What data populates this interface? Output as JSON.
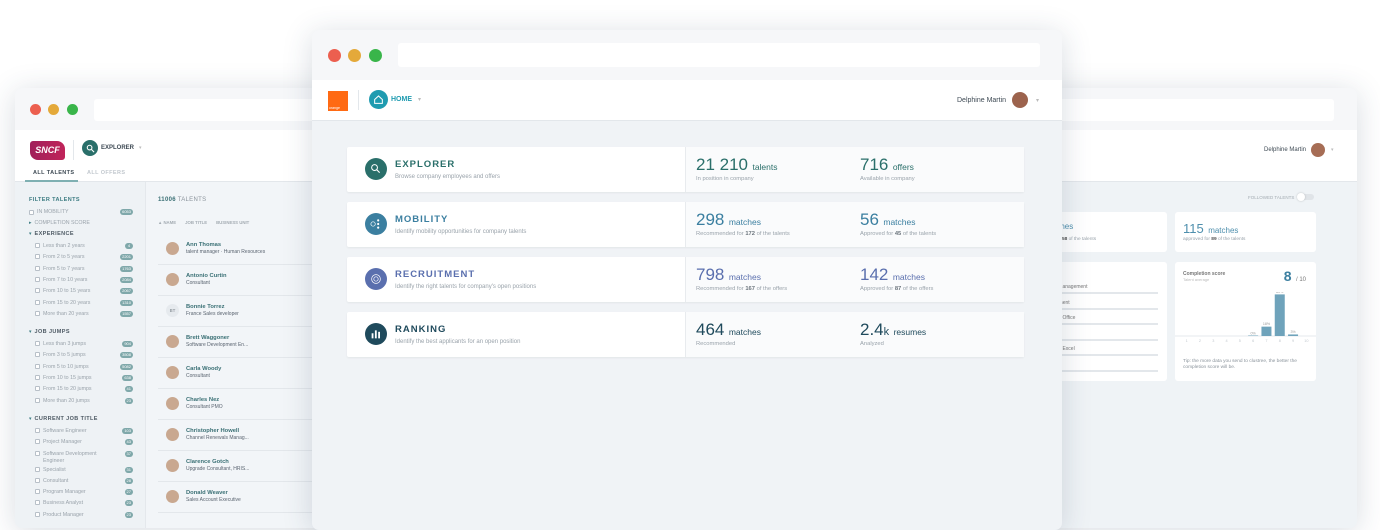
{
  "back_window": {
    "logo_text": "SNCF",
    "module_label": "EXPLORER",
    "tabs": [
      "ALL TALENTS",
      "ALL OFFERS"
    ],
    "user_name": "Delphine Martin",
    "followed_talents_label": "FOLLOWED TALENTS",
    "followed_talents_on": false,
    "filters": {
      "title": "FILTER TALENTS",
      "in_mobility": {
        "label": "IN MOBILITY",
        "count": "6053"
      },
      "completion_score": "COMPLETION SCORE",
      "groups": [
        {
          "title": "EXPERIENCE",
          "items": [
            {
              "label": "Less than 2 years",
              "count": "4"
            },
            {
              "label": "From 2 to 5 years",
              "count": "2201"
            },
            {
              "label": "From 5 to 7 years",
              "count": "1763"
            },
            {
              "label": "From 7 to 10 years",
              "count": "2084"
            },
            {
              "label": "From 10 to 15 years",
              "count": "2067"
            },
            {
              "label": "From 15 to 20 years",
              "count": "1310"
            },
            {
              "label": "More than 20 years",
              "count": "1557"
            }
          ]
        },
        {
          "title": "JOB JUMPS",
          "items": [
            {
              "label": "Less than 3 jumps",
              "count": "904"
            },
            {
              "label": "From 3 to 5 jumps",
              "count": "3508"
            },
            {
              "label": "From 5 to 10 jumps",
              "count": "5082"
            },
            {
              "label": "From 10 to 15 jumps",
              "count": "638"
            },
            {
              "label": "From 15 to 20 jumps",
              "count": "41"
            },
            {
              "label": "More than 20 jumps",
              "count": "23"
            }
          ]
        },
        {
          "title": "CURRENT JOB TITLE",
          "items": [
            {
              "label": "Software Engineer",
              "count": "103"
            },
            {
              "label": "Project Manager",
              "count": "43"
            },
            {
              "label": "Software Development Engineer",
              "count": "37"
            },
            {
              "label": "Specialist",
              "count": "31"
            },
            {
              "label": "Consultant",
              "count": "28"
            },
            {
              "label": "Program Manager",
              "count": "27"
            },
            {
              "label": "Business Analyst",
              "count": "23"
            },
            {
              "label": "Product Manager",
              "count": "23"
            }
          ]
        }
      ]
    },
    "talents": {
      "count_label": "11006",
      "count_suffix": "TALENTS",
      "columns": [
        "▲ NAME",
        "JOB TITLE",
        "BUSINESS UNIT"
      ],
      "rows": [
        {
          "name": "Ann Thomas",
          "title": "talent manager · Human Resources"
        },
        {
          "name": "Antonio Curtin",
          "title": "Consultant"
        },
        {
          "name": "Bonnie Torrez",
          "title": "France Sales developer",
          "initials": "BT"
        },
        {
          "name": "Brett Waggoner",
          "title": "Software Development En..."
        },
        {
          "name": "Carla Woody",
          "title": "Consultant"
        },
        {
          "name": "Charles Nez",
          "title": "Consultant PMO"
        },
        {
          "name": "Christopher Howell",
          "title": "Channel Renewals Manag..."
        },
        {
          "name": "Clarence Gotch",
          "title": "Upgrade Consultant, HRIS..."
        },
        {
          "name": "Donald Weaver",
          "title": "Sales Account Executive"
        }
      ]
    },
    "match_cards": [
      {
        "value": "",
        "unit": "matches",
        "sub_pre": "ded for",
        "sub_bold": "158",
        "sub_post": "of the talents"
      },
      {
        "value": "115",
        "unit": "matches",
        "sub_pre": "approved for",
        "sub_bold": "89",
        "sub_post": "of the talents"
      }
    ],
    "skills": {
      "title": "ills",
      "items": [
        {
          "label": "ct Management",
          "level": 0.05
        },
        {
          "label": "gement",
          "level": 0
        },
        {
          "label": "soft Office",
          "level": 0
        },
        {
          "label": "h",
          "level": 0
        },
        {
          "label": "soft Excel",
          "level": 0
        },
        {
          "label": "ting",
          "level": 0
        }
      ]
    },
    "completion": {
      "title": "Completion score",
      "subtitle": "Talent average",
      "score": "8",
      "out_of": "/ 10",
      "tip": "Tip: the more data you send to clustree, the better the completion score will be."
    }
  },
  "chart_data": {
    "type": "bar",
    "title": "Completion score",
    "categories": [
      "1",
      "2",
      "3",
      "4",
      "5",
      "6",
      "7",
      "8",
      "9",
      "10"
    ],
    "values": [
      null,
      null,
      null,
      null,
      null,
      0,
      18,
      80,
      3,
      null
    ],
    "labels": [
      "",
      "",
      "",
      "",
      "",
      "0%",
      "18%",
      "80%",
      "3%",
      ""
    ],
    "ylim": [
      0,
      100
    ],
    "color": "#6fa3bb"
  },
  "front_window": {
    "logo_text": "orange",
    "module_label": "HOME",
    "user_name": "Delphine Martin",
    "cards": [
      {
        "title": "EXPLORER",
        "desc": "Browse company employees and offers",
        "color": "#2a6f6a",
        "stats": [
          {
            "value": "21 210",
            "unit": "talents",
            "sub_pre": "In position in company",
            "sub_bold": "",
            "sub_post": ""
          },
          {
            "value": "716",
            "unit": "offers",
            "sub_pre": "Available in company",
            "sub_bold": "",
            "sub_post": ""
          }
        ]
      },
      {
        "title": "MOBILITY",
        "desc": "Identify mobility opportunities for company talents",
        "color": "#3b7fa0",
        "stats": [
          {
            "value": "298",
            "unit": "matches",
            "sub_pre": "Recommended for",
            "sub_bold": "172",
            "sub_post": "of the talents"
          },
          {
            "value": "56",
            "unit": "matches",
            "sub_pre": "Approved for",
            "sub_bold": "45",
            "sub_post": "of the talents"
          }
        ]
      },
      {
        "title": "RECRUITMENT",
        "desc": "Identify the right talents for company's open positions",
        "color": "#5a6fae",
        "stats": [
          {
            "value": "798",
            "unit": "matches",
            "sub_pre": "Recommended for",
            "sub_bold": "167",
            "sub_post": "of the offers"
          },
          {
            "value": "142",
            "unit": "matches",
            "sub_pre": "Approved for",
            "sub_bold": "87",
            "sub_post": "of the offers"
          }
        ]
      },
      {
        "title": "RANKING",
        "desc": "Identify the best applicants for an open position",
        "color": "#1f4a5c",
        "stats": [
          {
            "value": "464",
            "unit": "matches",
            "sub_pre": "Recommended",
            "sub_bold": "",
            "sub_post": ""
          },
          {
            "value": "2.4",
            "unit_small": "k",
            "unit": "resumes",
            "sub_pre": "Analyzed",
            "sub_bold": "",
            "sub_post": ""
          }
        ]
      }
    ]
  },
  "colors": {
    "red": "#ec5f4f",
    "yellow": "#e4a93a",
    "green": "#39b54a",
    "teal": "#2a6f6a",
    "orange": "#ff6a13"
  }
}
